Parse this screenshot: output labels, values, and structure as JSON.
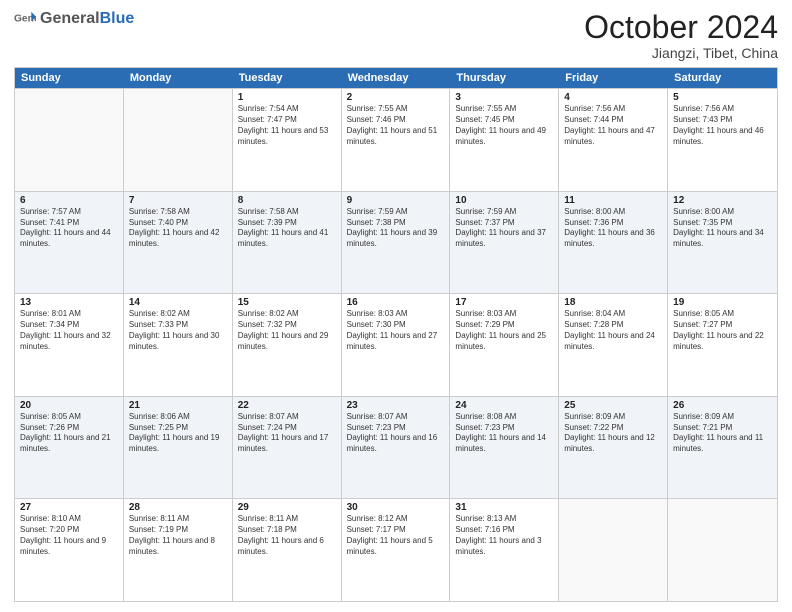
{
  "header": {
    "logo_general": "General",
    "logo_blue": "Blue",
    "month": "October 2024",
    "location": "Jiangzi, Tibet, China"
  },
  "days_of_week": [
    "Sunday",
    "Monday",
    "Tuesday",
    "Wednesday",
    "Thursday",
    "Friday",
    "Saturday"
  ],
  "weeks": [
    {
      "alt": false,
      "days": [
        {
          "num": "",
          "info": ""
        },
        {
          "num": "",
          "info": ""
        },
        {
          "num": "1",
          "info": "Sunrise: 7:54 AM\nSunset: 7:47 PM\nDaylight: 11 hours and 53 minutes."
        },
        {
          "num": "2",
          "info": "Sunrise: 7:55 AM\nSunset: 7:46 PM\nDaylight: 11 hours and 51 minutes."
        },
        {
          "num": "3",
          "info": "Sunrise: 7:55 AM\nSunset: 7:45 PM\nDaylight: 11 hours and 49 minutes."
        },
        {
          "num": "4",
          "info": "Sunrise: 7:56 AM\nSunset: 7:44 PM\nDaylight: 11 hours and 47 minutes."
        },
        {
          "num": "5",
          "info": "Sunrise: 7:56 AM\nSunset: 7:43 PM\nDaylight: 11 hours and 46 minutes."
        }
      ]
    },
    {
      "alt": true,
      "days": [
        {
          "num": "6",
          "info": "Sunrise: 7:57 AM\nSunset: 7:41 PM\nDaylight: 11 hours and 44 minutes."
        },
        {
          "num": "7",
          "info": "Sunrise: 7:58 AM\nSunset: 7:40 PM\nDaylight: 11 hours and 42 minutes."
        },
        {
          "num": "8",
          "info": "Sunrise: 7:58 AM\nSunset: 7:39 PM\nDaylight: 11 hours and 41 minutes."
        },
        {
          "num": "9",
          "info": "Sunrise: 7:59 AM\nSunset: 7:38 PM\nDaylight: 11 hours and 39 minutes."
        },
        {
          "num": "10",
          "info": "Sunrise: 7:59 AM\nSunset: 7:37 PM\nDaylight: 11 hours and 37 minutes."
        },
        {
          "num": "11",
          "info": "Sunrise: 8:00 AM\nSunset: 7:36 PM\nDaylight: 11 hours and 36 minutes."
        },
        {
          "num": "12",
          "info": "Sunrise: 8:00 AM\nSunset: 7:35 PM\nDaylight: 11 hours and 34 minutes."
        }
      ]
    },
    {
      "alt": false,
      "days": [
        {
          "num": "13",
          "info": "Sunrise: 8:01 AM\nSunset: 7:34 PM\nDaylight: 11 hours and 32 minutes."
        },
        {
          "num": "14",
          "info": "Sunrise: 8:02 AM\nSunset: 7:33 PM\nDaylight: 11 hours and 30 minutes."
        },
        {
          "num": "15",
          "info": "Sunrise: 8:02 AM\nSunset: 7:32 PM\nDaylight: 11 hours and 29 minutes."
        },
        {
          "num": "16",
          "info": "Sunrise: 8:03 AM\nSunset: 7:30 PM\nDaylight: 11 hours and 27 minutes."
        },
        {
          "num": "17",
          "info": "Sunrise: 8:03 AM\nSunset: 7:29 PM\nDaylight: 11 hours and 25 minutes."
        },
        {
          "num": "18",
          "info": "Sunrise: 8:04 AM\nSunset: 7:28 PM\nDaylight: 11 hours and 24 minutes."
        },
        {
          "num": "19",
          "info": "Sunrise: 8:05 AM\nSunset: 7:27 PM\nDaylight: 11 hours and 22 minutes."
        }
      ]
    },
    {
      "alt": true,
      "days": [
        {
          "num": "20",
          "info": "Sunrise: 8:05 AM\nSunset: 7:26 PM\nDaylight: 11 hours and 21 minutes."
        },
        {
          "num": "21",
          "info": "Sunrise: 8:06 AM\nSunset: 7:25 PM\nDaylight: 11 hours and 19 minutes."
        },
        {
          "num": "22",
          "info": "Sunrise: 8:07 AM\nSunset: 7:24 PM\nDaylight: 11 hours and 17 minutes."
        },
        {
          "num": "23",
          "info": "Sunrise: 8:07 AM\nSunset: 7:23 PM\nDaylight: 11 hours and 16 minutes."
        },
        {
          "num": "24",
          "info": "Sunrise: 8:08 AM\nSunset: 7:23 PM\nDaylight: 11 hours and 14 minutes."
        },
        {
          "num": "25",
          "info": "Sunrise: 8:09 AM\nSunset: 7:22 PM\nDaylight: 11 hours and 12 minutes."
        },
        {
          "num": "26",
          "info": "Sunrise: 8:09 AM\nSunset: 7:21 PM\nDaylight: 11 hours and 11 minutes."
        }
      ]
    },
    {
      "alt": false,
      "days": [
        {
          "num": "27",
          "info": "Sunrise: 8:10 AM\nSunset: 7:20 PM\nDaylight: 11 hours and 9 minutes."
        },
        {
          "num": "28",
          "info": "Sunrise: 8:11 AM\nSunset: 7:19 PM\nDaylight: 11 hours and 8 minutes."
        },
        {
          "num": "29",
          "info": "Sunrise: 8:11 AM\nSunset: 7:18 PM\nDaylight: 11 hours and 6 minutes."
        },
        {
          "num": "30",
          "info": "Sunrise: 8:12 AM\nSunset: 7:17 PM\nDaylight: 11 hours and 5 minutes."
        },
        {
          "num": "31",
          "info": "Sunrise: 8:13 AM\nSunset: 7:16 PM\nDaylight: 11 hours and 3 minutes."
        },
        {
          "num": "",
          "info": ""
        },
        {
          "num": "",
          "info": ""
        }
      ]
    }
  ]
}
